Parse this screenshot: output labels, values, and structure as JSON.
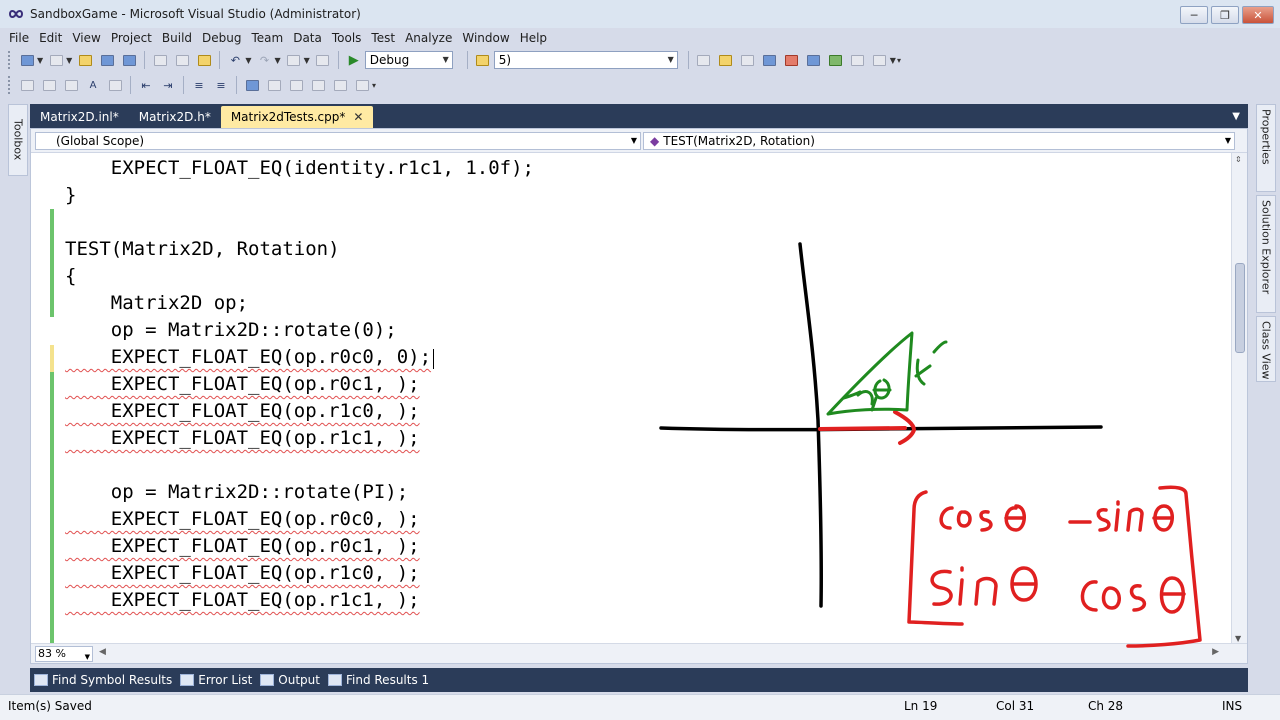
{
  "window": {
    "title": "SandboxGame - Microsoft Visual Studio (Administrator)",
    "minimize": "─",
    "restore": "❐",
    "close": "✕"
  },
  "menu": [
    "File",
    "Edit",
    "View",
    "Project",
    "Build",
    "Debug",
    "Team",
    "Data",
    "Tools",
    "Test",
    "Analyze",
    "Window",
    "Help"
  ],
  "toolbar": {
    "config": "Debug",
    "find": "5)"
  },
  "toolbox_label": "Toolbox",
  "right_panels": [
    "Properties",
    "Solution Explorer",
    "Class View"
  ],
  "tabs": [
    {
      "label": "Matrix2D.inl*",
      "active": false
    },
    {
      "label": "Matrix2D.h*",
      "active": false
    },
    {
      "label": "Matrix2dTests.cpp*",
      "active": true
    }
  ],
  "tab_close": "✕",
  "tabs_dropdown": "▼",
  "nav": {
    "scope": "(Global Scope)",
    "member": "TEST(Matrix2D, Rotation)"
  },
  "code": [
    "    EXPECT_FLOAT_EQ(identity.r1c1, 1.0f);",
    "}",
    "",
    "TEST(Matrix2D, Rotation)",
    "{",
    "    Matrix2D op;",
    "    op = Matrix2D::rotate(0);",
    "    EXPECT_FLOAT_EQ(op.r0c0, 0);",
    "    EXPECT_FLOAT_EQ(op.r0c1, );",
    "    EXPECT_FLOAT_EQ(op.r1c0, );",
    "    EXPECT_FLOAT_EQ(op.r1c1, );",
    "",
    "    op = Matrix2D::rotate(PI);",
    "    EXPECT_FLOAT_EQ(op.r0c0, );",
    "    EXPECT_FLOAT_EQ(op.r0c1, );",
    "    EXPECT_FLOAT_EQ(op.r1c0, );",
    "    EXPECT_FLOAT_EQ(op.r1c1, );"
  ],
  "zoom": "83 %",
  "bottom_tabs": [
    "Find Symbol Results",
    "Error List",
    "Output",
    "Find Results 1"
  ],
  "status": {
    "message": "Item(s) Saved",
    "ln": "Ln 19",
    "col": "Col 31",
    "ch": "Ch 28",
    "mode": "INS"
  },
  "annotation": {
    "theta_small": "θ",
    "matrix": [
      [
        "cosθ",
        "-sinθ"
      ],
      [
        "sinθ",
        "cosθ"
      ]
    ],
    "colors": {
      "axes": "#000000",
      "vector": "#e02020",
      "triangle": "#1f8a1f",
      "matrix": "#e02020"
    }
  }
}
